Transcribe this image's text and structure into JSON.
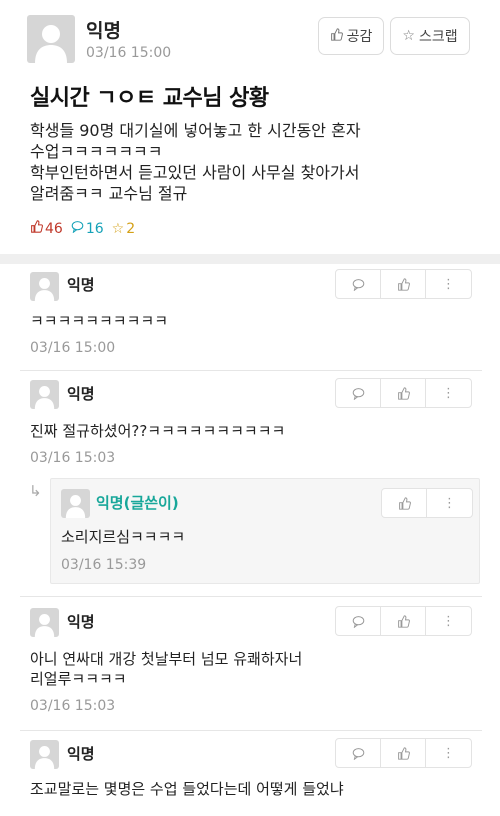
{
  "post": {
    "author": "익명",
    "time": "03/16 15:00",
    "empathy_label": "공감",
    "scrap_label": "스크랩",
    "title": "실시간 ㄱㅇㅌ 교수님 상황",
    "body_lines": [
      "학생들 90명 대기실에 넣어놓고 한 시간동안 혼자",
      "수업ㅋㅋㅋㅋㅋㅋㅋ",
      "학부인턴하면서 듣고있던 사람이 사무실 찾아가서",
      "알려줌ㅋㅋ 교수님 절규"
    ],
    "stats": {
      "likes": "46",
      "comments": "16",
      "scraps": "2"
    },
    "colors": {
      "like": "#c0392b",
      "comment": "#16a2b8",
      "scrap": "#d4a017"
    }
  },
  "comments": [
    {
      "author": "익명",
      "text": "ㅋㅋㅋㅋㅋㅋㅋㅋㅋㅋ",
      "time": "03/16 15:00"
    },
    {
      "author": "익명",
      "text": "진짜 절규하셨어??ㅋㅋㅋㅋㅋㅋㅋㅋㅋㅋ",
      "time": "03/16 15:03"
    },
    {
      "author": "익명",
      "text_lines": [
        "아니 연싸대 개강 첫날부터 넘모 유쾌하자너",
        "리얼루ㅋㅋㅋㅋ"
      ],
      "time": "03/16 15:03"
    },
    {
      "author": "익명",
      "text": "조교말로는 몇명은 수업 들었다는데 어떻게 들었냐"
    }
  ],
  "reply": {
    "author": "익명(글쓴이)",
    "text": "소리지르심ㅋㅋㅋㅋ",
    "time": "03/16 15:39",
    "color": "#18a79a"
  },
  "icons": {
    "like": "thumbs-up-icon",
    "comment": "speech-bubble-icon",
    "scrap": "star-icon",
    "more": "more-vertical-icon",
    "reply": "reply-arrow-icon",
    "avatar": "person-silhouette-icon"
  }
}
